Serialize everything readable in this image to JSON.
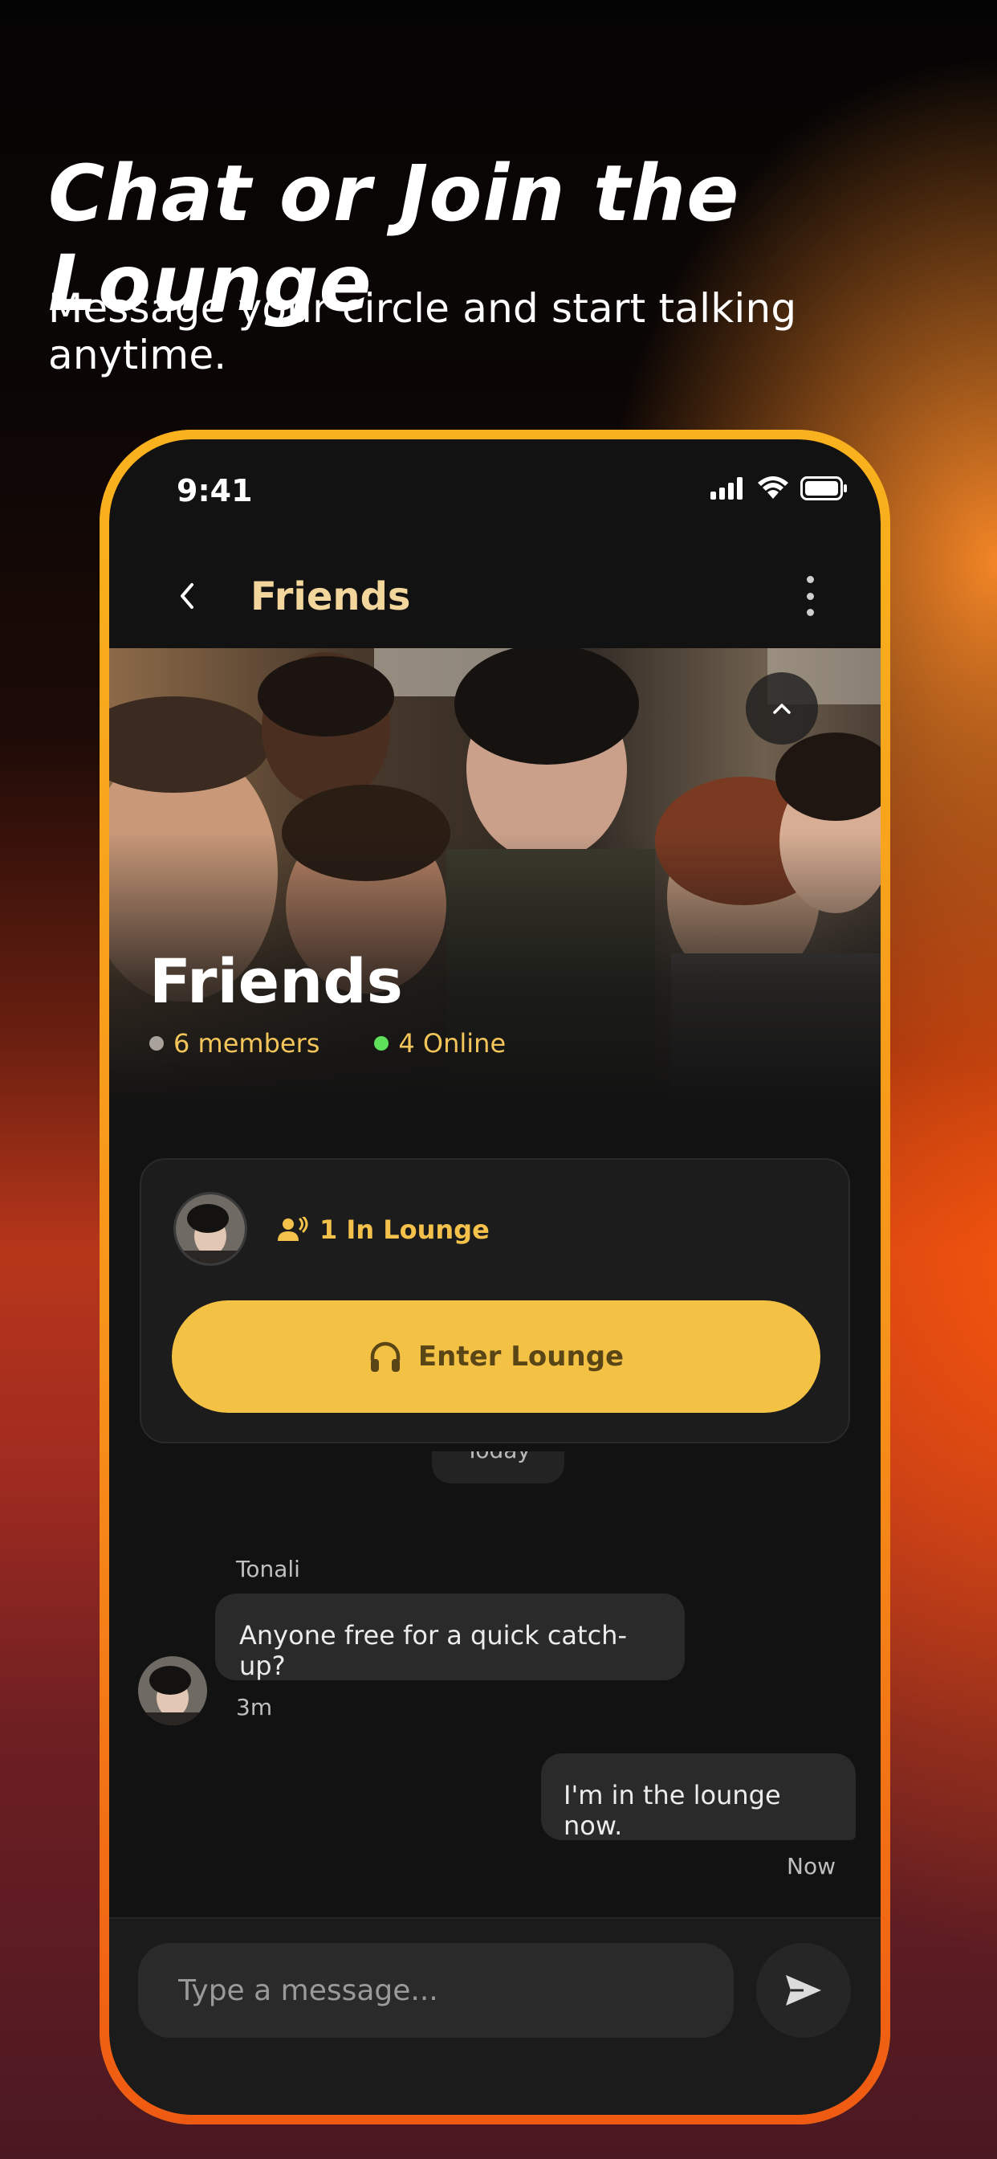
{
  "hero": {
    "title": "Chat or Join the Lounge",
    "subtitle": "Message your circle and start talking anytime."
  },
  "status_bar": {
    "time": "9:41"
  },
  "nav": {
    "title": "Friends"
  },
  "group": {
    "name": "Friends",
    "members": "6 members",
    "online": "4 Online"
  },
  "lounge": {
    "count_label": "1 In Lounge",
    "enter_label": "Enter Lounge"
  },
  "chat": {
    "day_label": "Today",
    "messages": [
      {
        "sender": "Tonali",
        "text": "Anyone free for a quick catch-up?",
        "time": "3m"
      },
      {
        "text": "I'm in the lounge now.",
        "time": "Now"
      }
    ]
  },
  "composer": {
    "placeholder": "Type a message..."
  },
  "colors": {
    "accent_yellow": "#f3c244",
    "nav_title": "#f3d69b",
    "online_green": "#5ee05a",
    "frame_orange": "#f7a01a"
  },
  "icons": [
    "back-chevron-icon",
    "more-vert-icon",
    "collapse-chevron-icon",
    "speaker-person-icon",
    "headphones-icon",
    "send-icon",
    "signal-icon",
    "wifi-icon",
    "battery-icon"
  ]
}
